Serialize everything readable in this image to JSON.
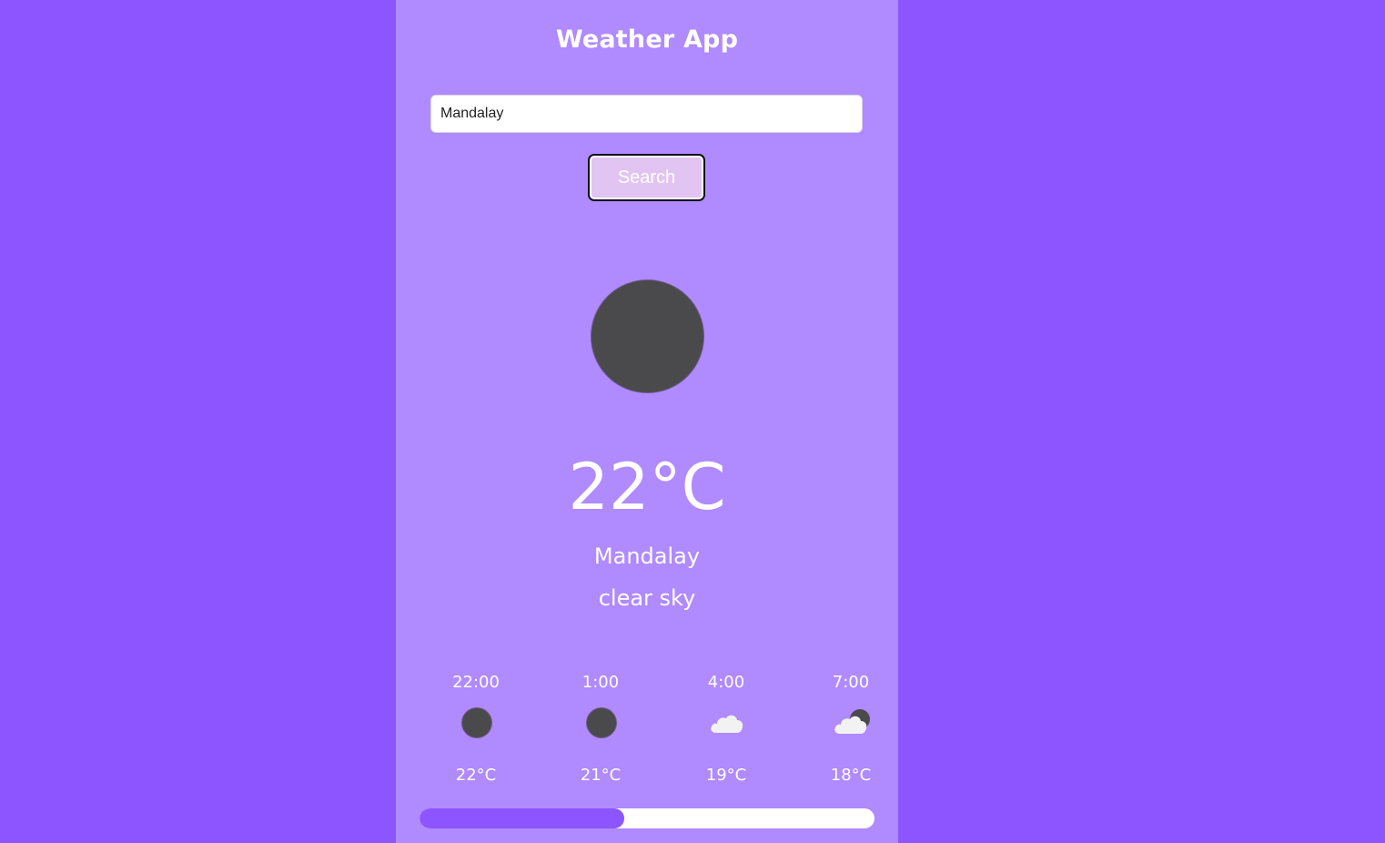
{
  "app": {
    "title": "Weather App"
  },
  "search": {
    "value": "Mandalay",
    "button_label": "Search"
  },
  "current": {
    "icon": "moon-icon",
    "temperature": "22°C",
    "city": "Mandalay",
    "description": "clear sky"
  },
  "forecast": [
    {
      "time": "22:00",
      "icon": "moon-icon",
      "temperature": "22°C"
    },
    {
      "time": "1:00",
      "icon": "moon-icon",
      "temperature": "21°C"
    },
    {
      "time": "4:00",
      "icon": "cloud-icon",
      "temperature": "19°C"
    },
    {
      "time": "7:00",
      "icon": "cloud-moon-icon",
      "temperature": "18°C"
    }
  ],
  "scroll_progress": 0.45,
  "colors": {
    "background": "#8c55ff",
    "panel": "#b08aff",
    "button": "#e2c4f2",
    "icon_dark": "#4a4a4c",
    "cloud": "#f2f2f2"
  }
}
